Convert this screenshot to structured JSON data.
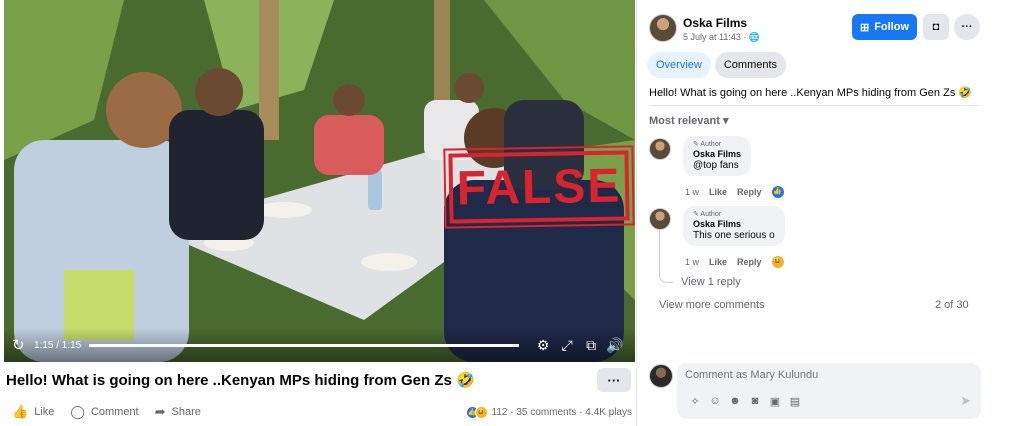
{
  "video": {
    "stamp_text": "FALSE",
    "time": "1:15 / 1:15",
    "progress_fraction": 1.0,
    "controls": [
      "settings-icon",
      "fullscreen-icon",
      "pip-icon",
      "volume-icon"
    ]
  },
  "post": {
    "title": "Hello! What is going on here ..Kenyan MPs hiding from Gen Zs 🤣",
    "more_label": "···",
    "actions": {
      "like": "Like",
      "comment": "Comment",
      "share": "Share"
    },
    "reactions_count": "112",
    "comments_count": "35 comments",
    "plays": "4.4K plays"
  },
  "panel": {
    "page_name": "Oska Films",
    "page_meta": "5 July at 11:43 · 🌐",
    "follow_label": "Follow",
    "tabs": [
      "Overview",
      "Comments"
    ],
    "caption": "Hello! What is going on here ..Kenyan MPs hiding from Gen Zs 🤣",
    "sort_label": "Most relevant ▾",
    "comments": [
      {
        "badge": "✎ Author",
        "name": "Oska Films",
        "text": "@top fans",
        "time": "1 w",
        "like": "Like",
        "reply": "Reply"
      },
      {
        "badge": "✎ Author",
        "name": "Oska Films",
        "text": "This one serious o",
        "time": "1 w",
        "like": "Like",
        "reply": "Reply"
      }
    ],
    "view_reply": "View 1 reply",
    "view_more": "View more comments",
    "count": "2 of 30",
    "composer_placeholder": "Comment as Mary Kulundu"
  },
  "colors": {
    "accent": "#1877f2",
    "stamp": "#d9232e",
    "muted": "#65676b",
    "bubble": "#f0f2f5"
  }
}
